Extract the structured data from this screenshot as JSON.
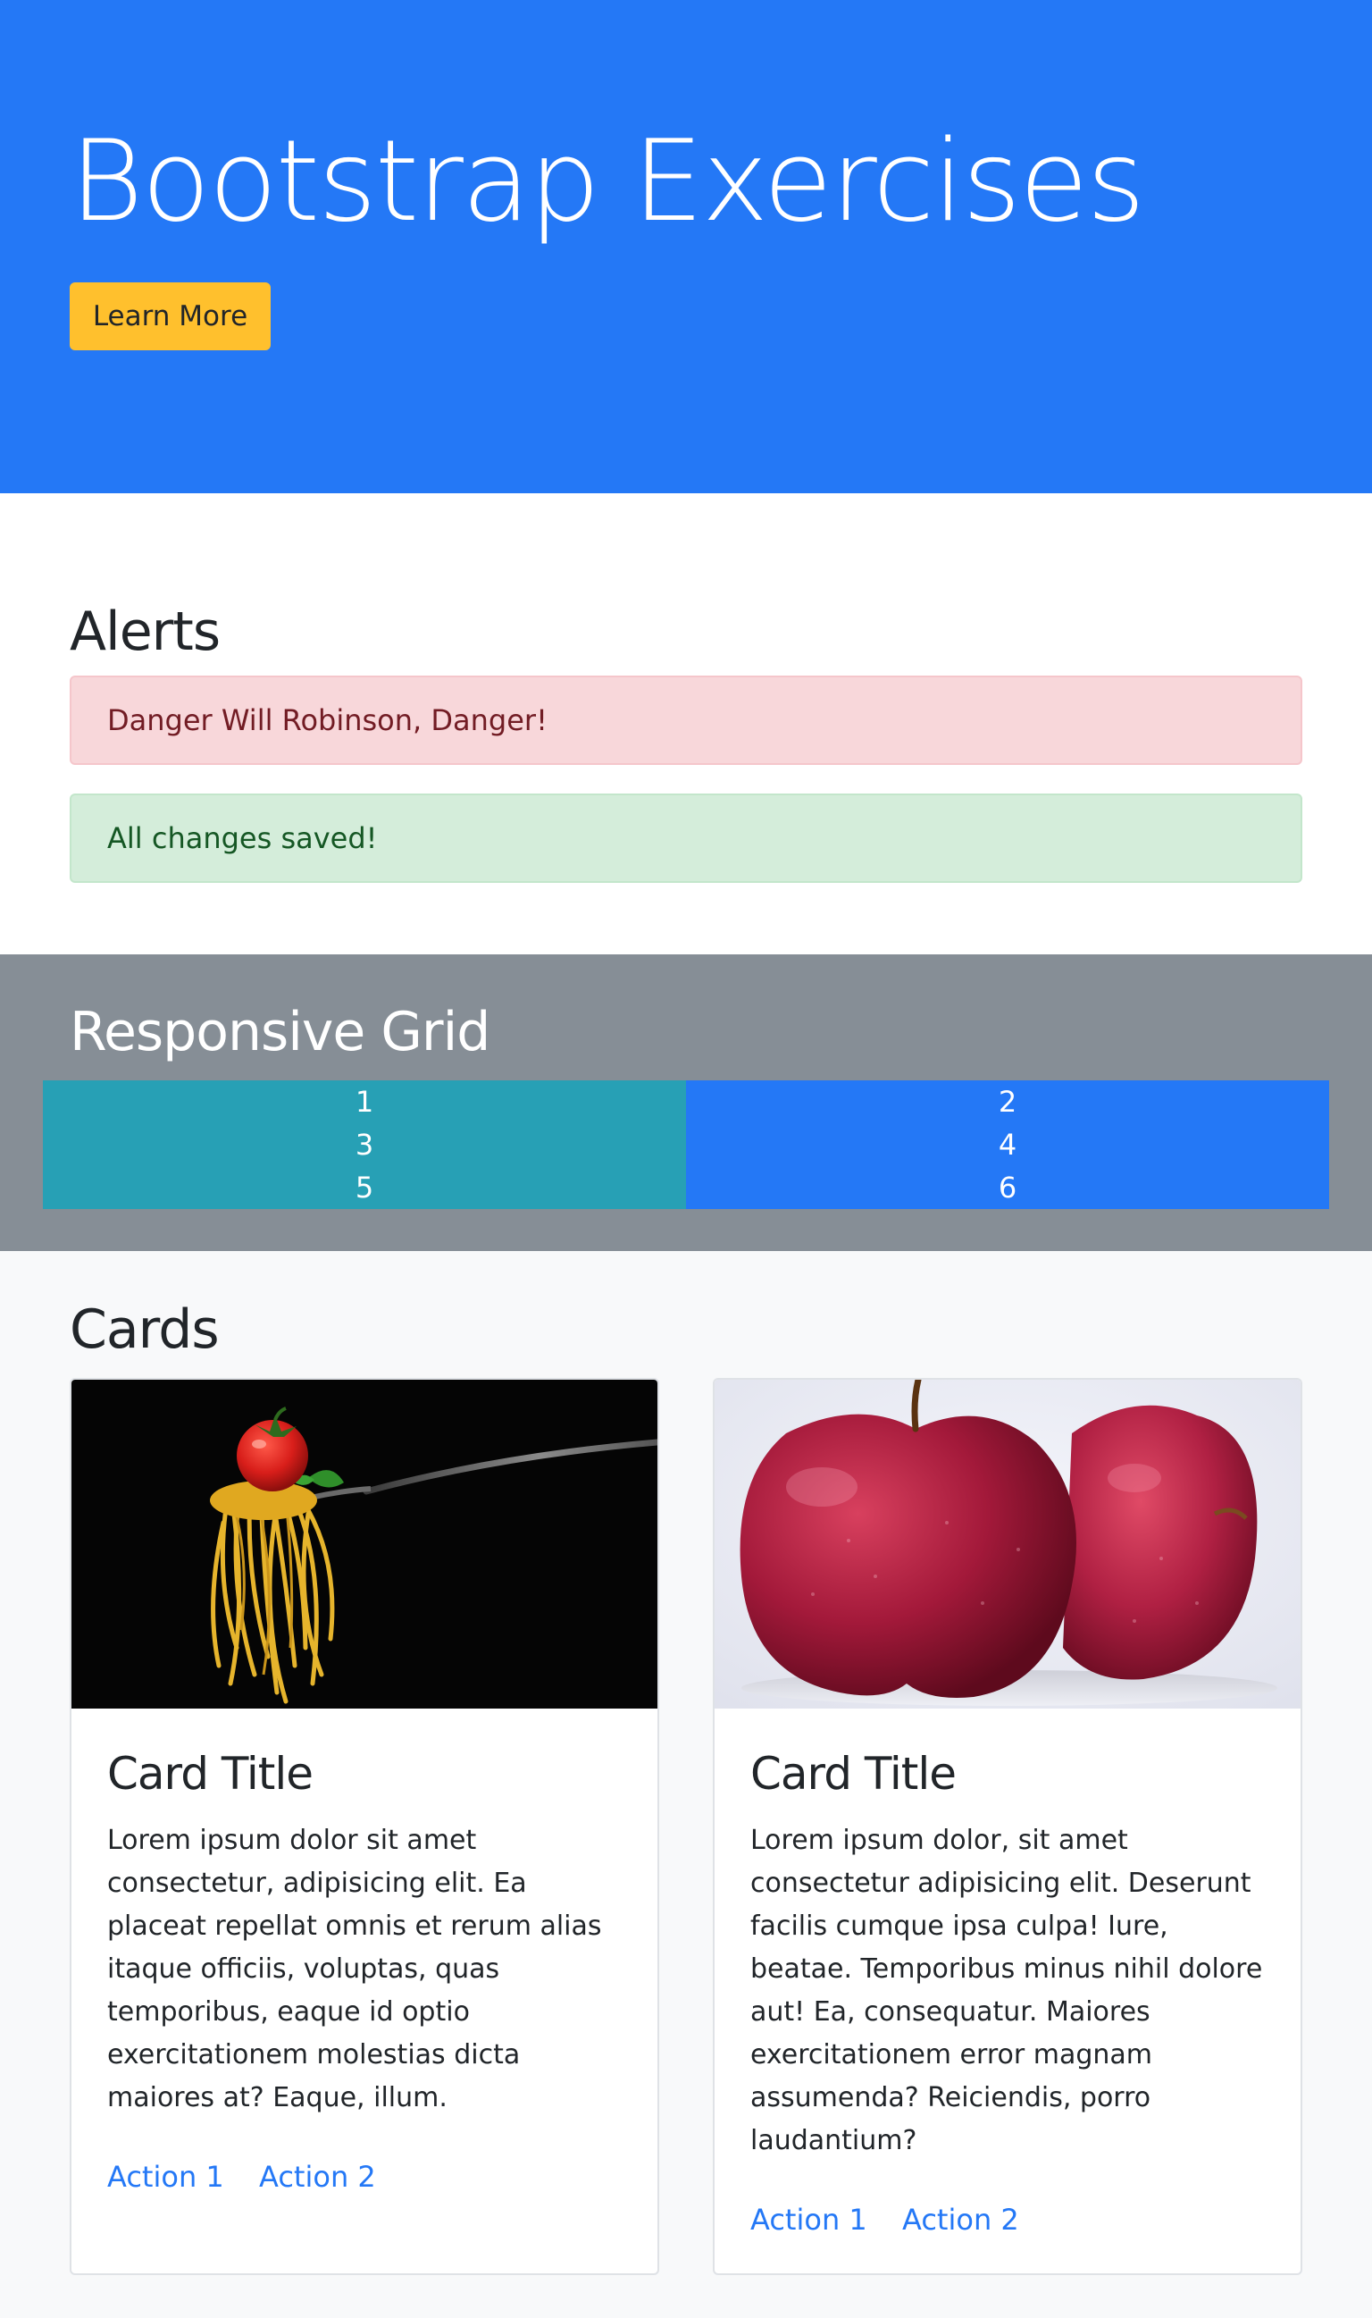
{
  "jumbotron": {
    "title": "Bootstrap Exercises",
    "button_label": "Learn More"
  },
  "alerts": {
    "heading": "Alerts",
    "danger_text": "Danger Will Robinson, Danger!",
    "success_text": "All changes saved!"
  },
  "grid": {
    "heading": "Responsive Grid",
    "cells": [
      "1",
      "2",
      "3",
      "4",
      "5",
      "6"
    ]
  },
  "cards": {
    "heading": "Cards",
    "items": [
      {
        "title": "Card Title",
        "text": "Lorem ipsum dolor sit amet consectetur, adipisicing elit. Ea placeat repellat omnis et rerum alias itaque officiis, voluptas, quas temporibus, eaque id optio exercitationem molestias dicta maiores at? Eaque, illum.",
        "action1": "Action 1",
        "action2": "Action 2",
        "image": "spaghetti-fork-with-tomato"
      },
      {
        "title": "Card Title",
        "text": "Lorem ipsum dolor, sit amet consectetur adipisicing elit. Deserunt facilis cumque ipsa culpa! Iure, beatae. Temporibus minus nihil dolore aut! Ea, consequatur. Maiores exercitationem error magnam assumenda? Reiciendis, porro laudantium?",
        "action1": "Action 1",
        "action2": "Action 2",
        "image": "two-red-apples"
      }
    ]
  },
  "colors": {
    "primary": "#2478f6",
    "warning": "#ffc02d",
    "info": "#27a0b5",
    "secondary": "#868e96",
    "light": "#f8f9fa"
  }
}
